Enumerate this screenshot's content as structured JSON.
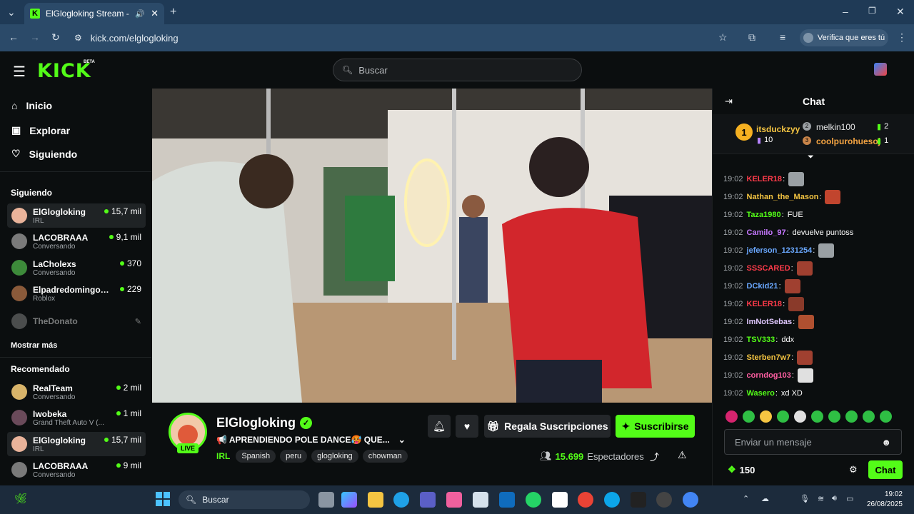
{
  "browser": {
    "tab_title": "ElGlogloking Stream - Wato",
    "url": "kick.com/elglogloking",
    "verify_label": "Verifica que eres tú"
  },
  "header": {
    "logo": "KICK",
    "beta": "BETA",
    "search_placeholder": "Buscar"
  },
  "sidebar": {
    "nav": [
      {
        "label": "Inicio",
        "icon": "home-icon"
      },
      {
        "label": "Explorar",
        "icon": "compass-icon"
      },
      {
        "label": "Siguiendo",
        "icon": "heart-icon"
      }
    ],
    "following_title": "Siguiendo",
    "following": [
      {
        "name": "ElGlogloking",
        "category": "IRL",
        "viewers": "15,7 mil"
      },
      {
        "name": "LACOBRAAA",
        "category": "Conversando",
        "viewers": "9,1 mil"
      },
      {
        "name": "LaCholexs",
        "category": "Conversando",
        "viewers": "370"
      },
      {
        "name": "ElpadredomingoO...",
        "category": "Roblox",
        "viewers": "229"
      },
      {
        "name": "TheDonato",
        "category": "",
        "viewers": ""
      }
    ],
    "show_more": "Mostrar más",
    "recommended_title": "Recomendado",
    "recommended": [
      {
        "name": "RealTeam",
        "category": "Conversando",
        "viewers": "2 mil"
      },
      {
        "name": "Iwobeka",
        "category": "Grand Theft Auto V (...",
        "viewers": "1 mil"
      },
      {
        "name": "ElGlogloking",
        "category": "IRL",
        "viewers": "15,7 mil"
      },
      {
        "name": "LACOBRAAA",
        "category": "Conversando",
        "viewers": "9 mil"
      }
    ]
  },
  "stream": {
    "name": "ElGlogloking",
    "live": "LIVE",
    "title": "📢 APRENDIENDO POLE DANCE🥵 QUE...",
    "category": "IRL",
    "tags": [
      "Spanish",
      "peru",
      "glogloking",
      "chowman"
    ],
    "gift_label": "Regala Suscripciones",
    "subscribe_label": "Suscribirse",
    "viewers": "15.699",
    "viewers_label": "Espectadores"
  },
  "chat": {
    "title": "Chat",
    "leaderboard": [
      {
        "rank": "1",
        "name": "itsduckzyy",
        "value": "10"
      },
      {
        "rank": "2",
        "name": "melkin100",
        "value": "2"
      },
      {
        "rank": "3",
        "name": "coolpurohuesoj",
        "value": "1"
      }
    ],
    "messages": [
      {
        "time": "19:02",
        "user": "KELER18",
        "color": "#ff3b4a",
        "text": "",
        "emote": true
      },
      {
        "time": "19:02",
        "user": "Nathan_the_Mason",
        "color": "#f5c542",
        "text": "",
        "emote": true
      },
      {
        "time": "19:02",
        "user": "Taza1980",
        "color": "#53fc18",
        "text": "FUE",
        "emote": false
      },
      {
        "time": "19:02",
        "user": "Camilo_97",
        "color": "#c678ff",
        "text": "devuelve puntoss",
        "emote": false
      },
      {
        "time": "19:02",
        "user": "jeferson_1231254",
        "color": "#6aa8ff",
        "text": "",
        "emote": true
      },
      {
        "time": "19:02",
        "user": "SSSCARED",
        "color": "#ff3b4a",
        "text": "",
        "emote": true
      },
      {
        "time": "19:02",
        "user": "DCkid21",
        "color": "#6aa8ff",
        "text": "",
        "emote": true
      },
      {
        "time": "19:02",
        "user": "KELER18",
        "color": "#ff3b4a",
        "text": "",
        "emote": true
      },
      {
        "time": "19:02",
        "user": "ImNotSebas",
        "color": "#e0c8ff",
        "text": "",
        "emote": true
      },
      {
        "time": "19:02",
        "user": "TSV333",
        "color": "#53fc18",
        "text": "ddx",
        "emote": false
      },
      {
        "time": "19:02",
        "user": "Sterben7w7",
        "color": "#f5c542",
        "text": "",
        "emote": true
      },
      {
        "time": "19:02",
        "user": "corndog103",
        "color": "#ff5fa2",
        "text": "",
        "emote": true
      },
      {
        "time": "19:02",
        "user": "Wasero",
        "color": "#53fc18",
        "text": "xd XD",
        "emote": false
      }
    ],
    "input_placeholder": "Enviar un mensaje",
    "points": "150",
    "send_label": "Chat"
  },
  "taskbar": {
    "search_label": "Buscar",
    "time": "19:02",
    "date": "26/08/2025"
  },
  "colors": {
    "accent": "#53fc18",
    "background": "#0b0e0f",
    "chrome": "#2b4a69"
  }
}
